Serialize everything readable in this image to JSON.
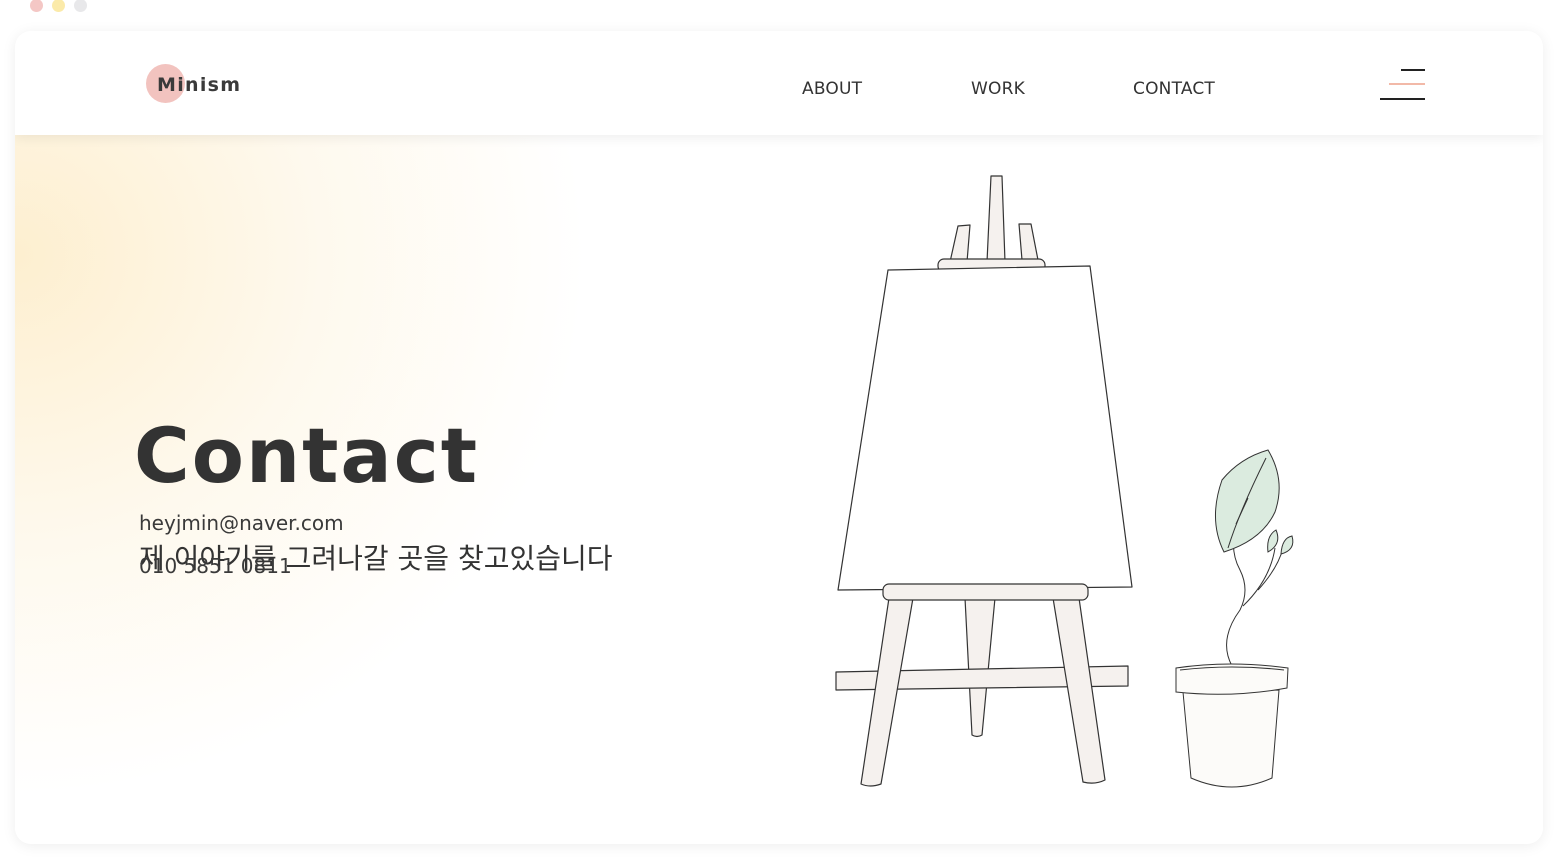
{
  "window_controls": {
    "colors": [
      "#f4c7c5",
      "#fbeaa9",
      "#e8e8ea"
    ]
  },
  "header": {
    "logo_text": "Minism",
    "logo_circle_color": "#f2c3bf",
    "nav": [
      {
        "label": "ABOUT"
      },
      {
        "label": "WORK"
      },
      {
        "label": "CONTACT"
      }
    ],
    "menu_icon": "hamburger-menu-icon",
    "menu_accent_color": "#f2b9a8"
  },
  "hero": {
    "title": "Contact",
    "subtitle": "제 이야기를 그려나갈 곳을 찾고있습니다",
    "email": "heyjmin@naver.com",
    "phone": "010 5851 0811",
    "illustration": {
      "easel_icon": "easel-icon",
      "plant_icon": "potted-plant-icon",
      "leaf_color": "#dbebdf",
      "wood_color": "#f5f1ee"
    }
  }
}
